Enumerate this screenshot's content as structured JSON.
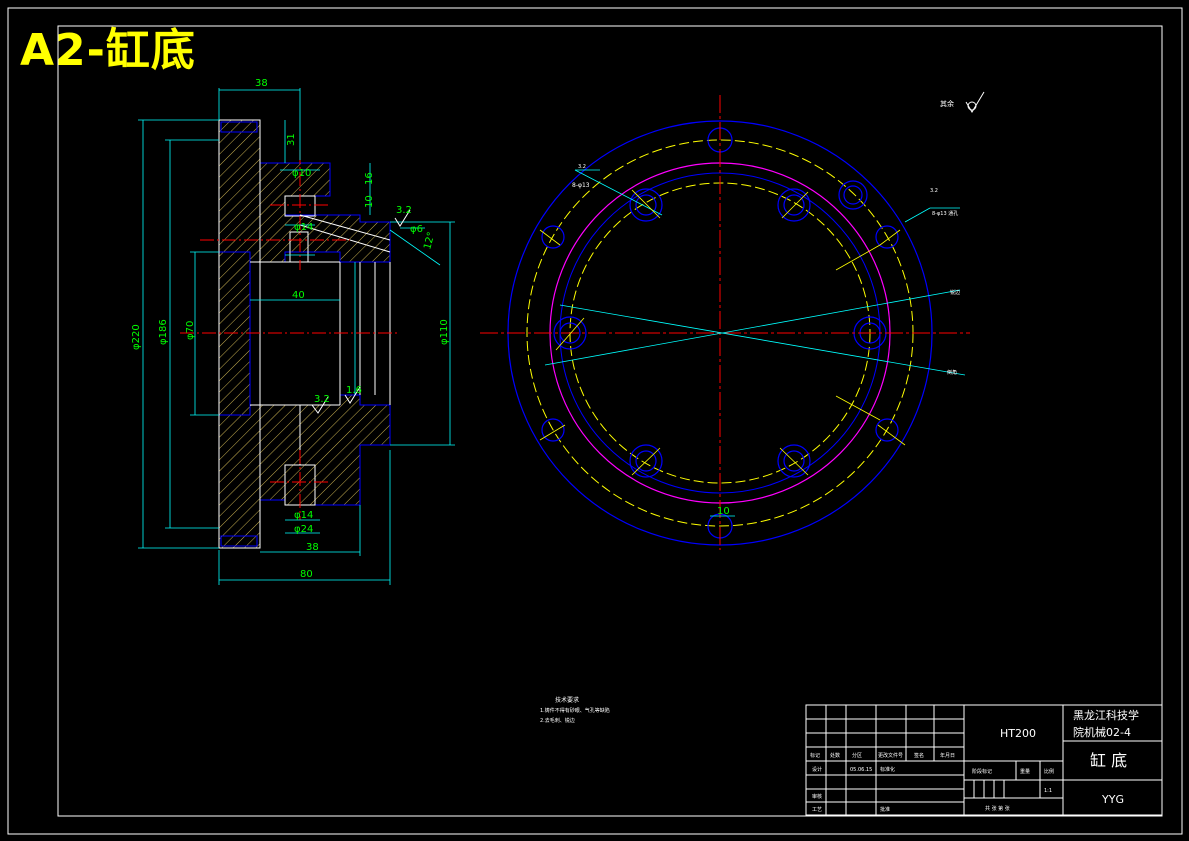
{
  "sheet_title": "A2-缸底",
  "colors": {
    "background": "#000000",
    "outline": "#ffffff",
    "part": "#0000ff",
    "hatch": "#d8c060",
    "centerline": "#ff0000",
    "dimension": "#00ff00",
    "leader": "#00ffff",
    "pitch_circle": "#ffff00",
    "bore_circle": "#ff00ff"
  },
  "section_view": {
    "dims": {
      "top_width": "38",
      "flange_thk": "31",
      "dia_outer": "φ220",
      "dia_pitch": "φ186",
      "angle": "12°",
      "small_a": "φ10",
      "small_b": "φ14",
      "small_c": "φ6",
      "small_d": "16",
      "small_e": "10",
      "rough_1": "3.2",
      "rough_2": "3.2",
      "bottom_1": "φ14",
      "bottom_2": "φ24",
      "bottom_3": "38",
      "overall_len": "80",
      "bore": "φ110",
      "bore_inner": "φ70",
      "depth": "40",
      "rough_3": "1.6"
    }
  },
  "front_view": {
    "roughness_symbol": "其余",
    "leader_1": "8-φ13",
    "leader_2": "8-φ13 通孔",
    "leader_3": "锐边",
    "leader_4": "倒角",
    "bottom_dim": "10",
    "rough_a": "3.2",
    "rough_b": "3.2"
  },
  "notes": {
    "heading": "技术要求",
    "line1": "1.铸件不得有砂眼、气孔等缺陷",
    "line2": "2.去毛刺、锐边"
  },
  "title_block": {
    "material": "HT200",
    "school_line1": "黑龙江科技学",
    "school_line2": "院机械02-4",
    "part_name": "缸 底",
    "drawer": "YYG",
    "row_labels": [
      "标记",
      "处数",
      "分区",
      "更改文件号",
      "签名",
      "年月日"
    ],
    "design_label": "设计",
    "standard_label": "标准化",
    "check_label": "审核",
    "process_label": "工艺",
    "approve_label": "批准",
    "stage_label": "阶段标记",
    "weight_label": "重量",
    "scale_label": "比例",
    "scale_value": "1:1",
    "sheet_info": "共 张 第 张",
    "date_value": "05.06.15"
  }
}
